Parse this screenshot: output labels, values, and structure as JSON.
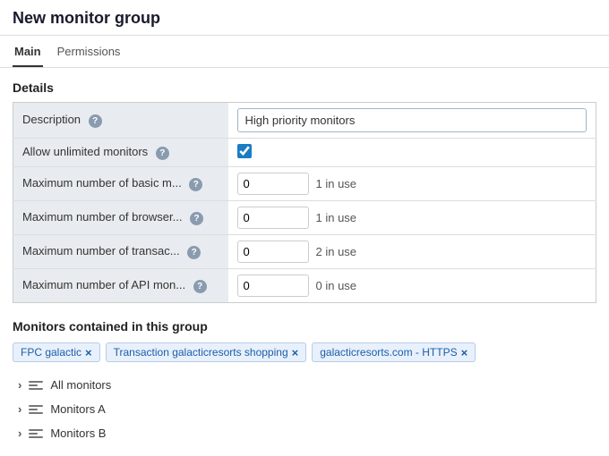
{
  "header": {
    "title": "New monitor group"
  },
  "tabs": [
    {
      "id": "main",
      "label": "Main",
      "active": true
    },
    {
      "id": "permissions",
      "label": "Permissions",
      "active": false
    }
  ],
  "details": {
    "section_title": "Details",
    "rows": [
      {
        "id": "description",
        "label": "Description",
        "type": "text",
        "value": "High priority monitors",
        "placeholder": ""
      },
      {
        "id": "allow-unlimited",
        "label": "Allow unlimited monitors",
        "type": "checkbox",
        "checked": true
      },
      {
        "id": "max-basic",
        "label": "Maximum number of basic m...",
        "type": "number",
        "value": "0",
        "usage": "1 in use"
      },
      {
        "id": "max-browser",
        "label": "Maximum number of browser...",
        "type": "number",
        "value": "0",
        "usage": "1 in use"
      },
      {
        "id": "max-transac",
        "label": "Maximum number of transac...",
        "type": "number",
        "value": "0",
        "usage": "2 in use"
      },
      {
        "id": "max-api",
        "label": "Maximum number of API mon...",
        "type": "number",
        "value": "0",
        "usage": "0 in use"
      }
    ]
  },
  "monitors_group": {
    "section_title": "Monitors contained in this group",
    "tags": [
      {
        "id": "fpc-galactic",
        "label": "FPC galactic"
      },
      {
        "id": "transaction-galactic",
        "label": "Transaction galacticresorts shopping"
      },
      {
        "id": "galactic-https",
        "label": "galacticresorts.com - HTTPS"
      }
    ],
    "list_items": [
      {
        "id": "all-monitors",
        "label": "All monitors"
      },
      {
        "id": "monitors-a",
        "label": "Monitors A"
      },
      {
        "id": "monitors-b",
        "label": "Monitors B"
      }
    ]
  },
  "icons": {
    "help": "?",
    "chevron_right": "›",
    "close": "×"
  }
}
